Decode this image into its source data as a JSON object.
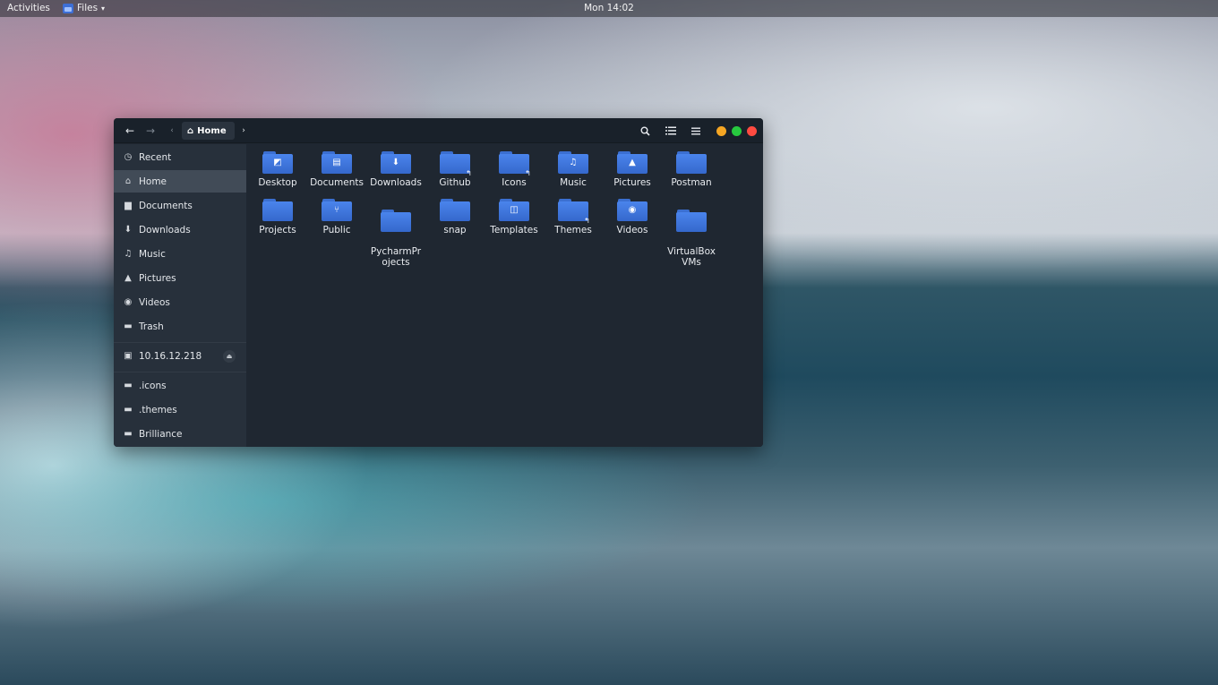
{
  "topbar": {
    "activities": "Activities",
    "app_name": "Files",
    "clock": "Mon 14:02"
  },
  "window": {
    "path": {
      "current": "Home"
    },
    "controls": {
      "minimize_color": "#f5a623",
      "maximize_color": "#27c93f",
      "close_color": "#ff4b41"
    }
  },
  "sidebar": {
    "items": [
      {
        "label": "Recent",
        "icon": "clock-icon"
      },
      {
        "label": "Home",
        "icon": "home-icon",
        "active": true
      },
      {
        "label": "Documents",
        "icon": "document-icon"
      },
      {
        "label": "Downloads",
        "icon": "download-icon"
      },
      {
        "label": "Music",
        "icon": "headphones-icon"
      },
      {
        "label": "Pictures",
        "icon": "image-icon"
      },
      {
        "label": "Videos",
        "icon": "video-icon"
      },
      {
        "label": "Trash",
        "icon": "trash-icon"
      }
    ],
    "network": {
      "label": "10.16.12.218",
      "icon": "network-drive-icon"
    },
    "bookmarks": [
      {
        "label": ".icons",
        "icon": "folder-icon"
      },
      {
        "label": ".themes",
        "icon": "folder-icon"
      },
      {
        "label": "Brilliance",
        "icon": "folder-icon"
      }
    ]
  },
  "files": [
    {
      "label": "Desktop",
      "emblem": "desktop-emblem"
    },
    {
      "label": "Documents",
      "emblem": "document-emblem"
    },
    {
      "label": "Downloads",
      "emblem": "download-emblem"
    },
    {
      "label": "Github",
      "emblem": "symlink-emblem"
    },
    {
      "label": "Icons",
      "emblem": "symlink-emblem"
    },
    {
      "label": "Music",
      "emblem": "music-emblem"
    },
    {
      "label": "Pictures",
      "emblem": "image-emblem"
    },
    {
      "label": "Postman",
      "emblem": "none"
    },
    {
      "label": "Projects",
      "emblem": "none"
    },
    {
      "label": "Public",
      "emblem": "share-emblem"
    },
    {
      "label": "PycharmPr\nojects",
      "emblem": "none"
    },
    {
      "label": "snap",
      "emblem": "none"
    },
    {
      "label": "Templates",
      "emblem": "template-emblem"
    },
    {
      "label": "Themes",
      "emblem": "symlink-emblem"
    },
    {
      "label": "Videos",
      "emblem": "video-emblem"
    },
    {
      "label": "VirtualBox\nVMs",
      "emblem": "none"
    }
  ]
}
